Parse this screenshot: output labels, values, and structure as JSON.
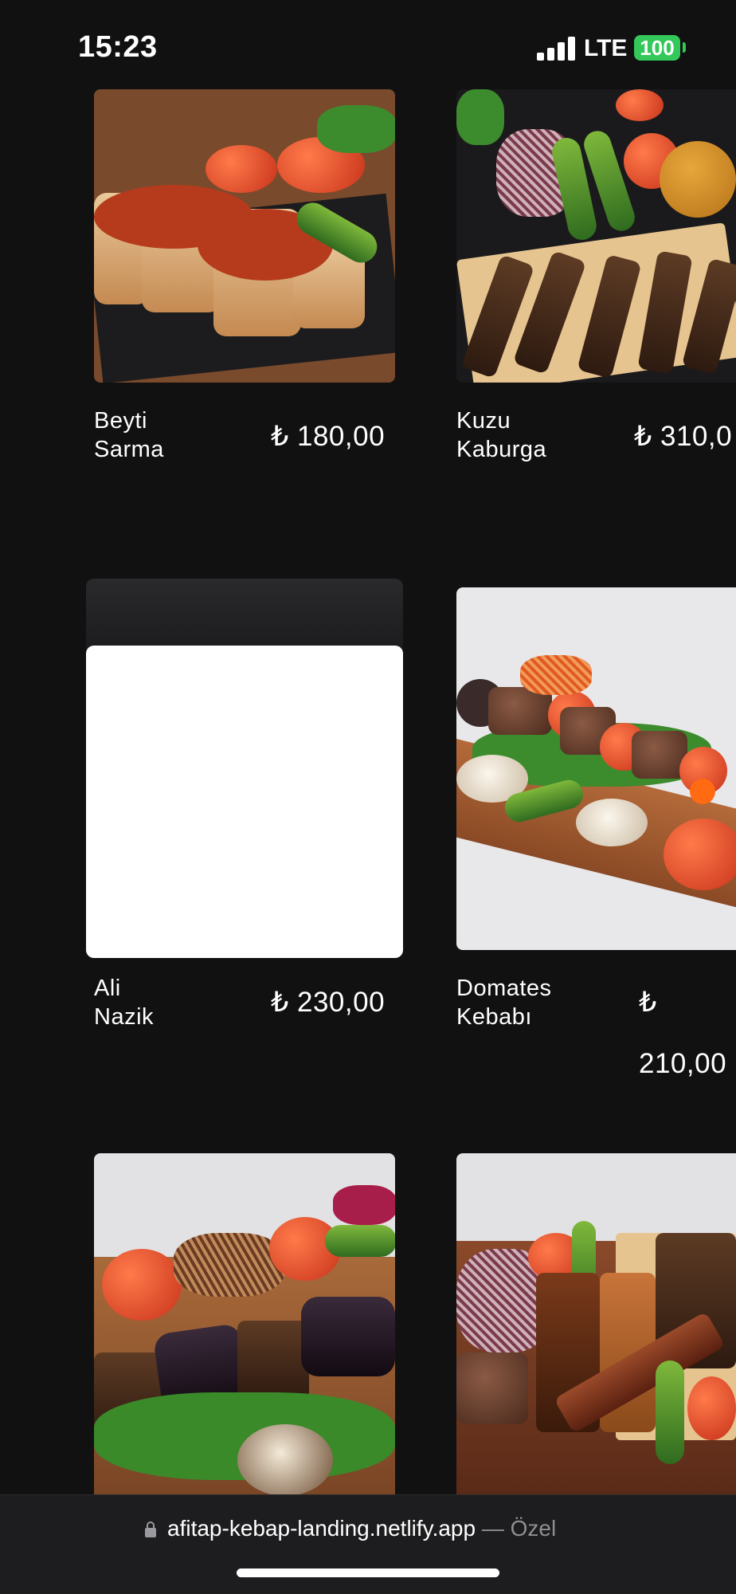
{
  "status_bar": {
    "time": "15:23",
    "network": "LTE",
    "battery": "100"
  },
  "menu_items": [
    {
      "name": "Beyti Sarma",
      "price": "₺ 180,00"
    },
    {
      "name": "Kuzu Kaburga",
      "price": "₺ 310,0"
    },
    {
      "name": "Ali Nazik",
      "price": "₺ 230,00"
    },
    {
      "name": "Domates Kebabı",
      "price_symbol": "₺",
      "price_value": "210,00"
    }
  ],
  "browser": {
    "url": "afitap-kebap-landing.netlify.app",
    "separator": " — ",
    "mode": "Özel"
  },
  "colors": {
    "background": "#111112",
    "accent": "#ff6a13",
    "battery": "#34c759"
  }
}
